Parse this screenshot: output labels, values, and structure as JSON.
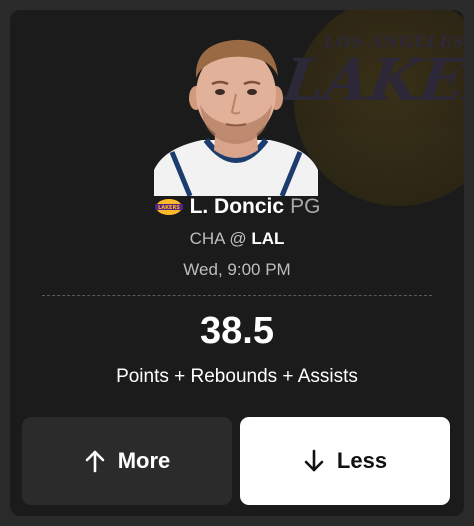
{
  "background_logo": {
    "top_word": "LOS ANGELES",
    "main_word": "LAKERS"
  },
  "player": {
    "name": "L. Doncic",
    "position": "PG",
    "team_badge_text": "LAKERS"
  },
  "game": {
    "away_team": "CHA",
    "separator": "@",
    "home_team": "LAL",
    "time": "Wed, 9:00 PM"
  },
  "projection": {
    "line": "38.5",
    "stat": "Points + Rebounds + Assists"
  },
  "buttons": {
    "more_label": "More",
    "less_label": "Less"
  },
  "colors": {
    "card_bg": "#1b1b1b",
    "more_button_bg": "#2b2b2b",
    "less_button_bg": "#ffffff",
    "lakers_purple": "#552583",
    "lakers_gold": "#FDB927"
  },
  "icons": {
    "more": "arrow-up-icon",
    "less": "arrow-down-icon"
  }
}
